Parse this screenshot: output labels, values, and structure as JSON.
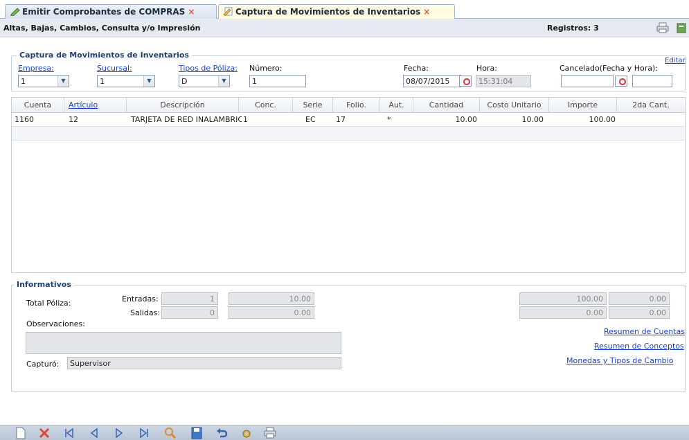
{
  "tabs": [
    {
      "label": "Emitir Comprobantes de COMPRAS",
      "close": "×"
    },
    {
      "label": "Captura de Movimientos de Inventarios",
      "close": "×"
    }
  ],
  "header": {
    "title": "Altas, Bajas, Cambios, Consulta y/o Impresión",
    "records": "Registros: 3"
  },
  "capture": {
    "legend": "Captura de Movimientos de Inventarios",
    "edit_link": "Editar",
    "empresa_label": "Empresa:",
    "empresa_value": "1",
    "sucursal_label": "Sucursal:",
    "sucursal_value": "1",
    "tipos_label": "Tipos de Póliza:",
    "tipos_value": "D",
    "numero_label": "Número:",
    "numero_value": "1",
    "fecha_label": "Fecha:",
    "fecha_value": "08/07/2015",
    "hora_label": "Hora:",
    "hora_value": "15:31:04",
    "cancelado_label": "Cancelado(Fecha y Hora):",
    "cancelado_date": "",
    "cancelado_time": ""
  },
  "grid": {
    "columns": [
      "Cuenta",
      "Artículo",
      "Descripción",
      "Conc.",
      "Serie",
      "Folio.",
      "Aut.",
      "Cantidad",
      "Costo Unitario",
      "Importe",
      "2da Cant."
    ],
    "rows": [
      {
        "cuenta": "1160",
        "articulo": "12",
        "descripcion": "TARJETA DE RED INALAMBRICA",
        "conc": "1",
        "serie": "EC",
        "folio": "17",
        "aut": "*",
        "cantidad": "10.00",
        "costo": "10.00",
        "importe": "100.00",
        "segunda": ""
      }
    ]
  },
  "info": {
    "legend": "Informativos",
    "total_label": "Total Póliza:",
    "entradas_label": "Entradas:",
    "entradas_count": "1",
    "entradas_amount": "10.00",
    "salidas_label": "Salidas:",
    "salidas_count": "0",
    "salidas_amount": "0.00",
    "right_row1_a": "100.00",
    "right_row1_b": "0.00",
    "right_row2_a": "0.00",
    "right_row2_b": "0.00",
    "observaciones_label": "Observaciones:",
    "observaciones_value": "",
    "capturo_label": "Capturó:",
    "capturo_value": "Supervisor",
    "link_cuentas": "Resumen de Cuentas",
    "link_conceptos": "Resumen de Conceptos",
    "link_monedas": "Monedas y Tipos de Cambio"
  },
  "toolbar": {
    "icons": [
      "new-icon",
      "delete-icon",
      "first-record-icon",
      "previous-record-icon",
      "next-record-icon",
      "last-record-icon",
      "search-icon",
      "save-icon",
      "undo-icon",
      "tools-icon",
      "print-icon"
    ]
  },
  "colors": {
    "accent": "#1f3f7a",
    "link": "#1b3fd3",
    "close": "#e5553b",
    "toolbar": "#c3cfde"
  }
}
